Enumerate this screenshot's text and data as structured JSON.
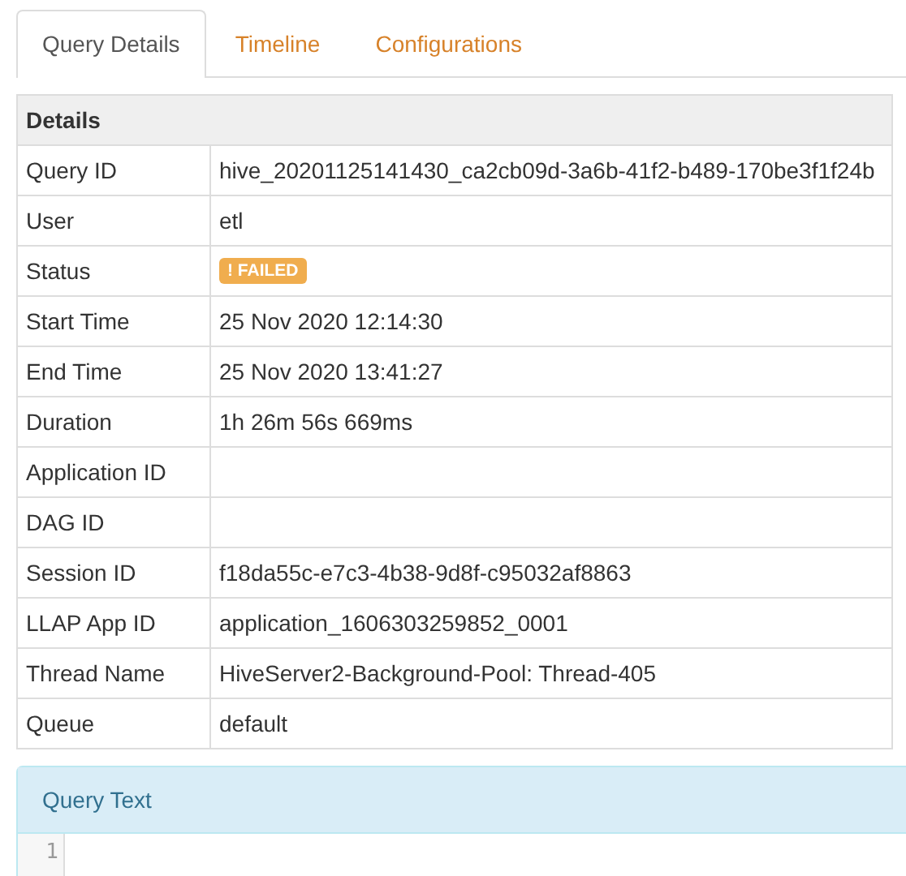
{
  "tabs": [
    {
      "label": "Query Details",
      "selected": true
    },
    {
      "label": "Timeline",
      "selected": false
    },
    {
      "label": "Configurations",
      "selected": false
    }
  ],
  "details": {
    "title": "Details",
    "rows": [
      {
        "label": "Query ID",
        "kind": "text",
        "value": "hive_20201125141430_ca2cb09d-3a6b-41f2-b489-170be3f1f24b"
      },
      {
        "label": "User",
        "kind": "text",
        "value": "etl"
      },
      {
        "label": "Status",
        "kind": "badge",
        "value": "! FAILED",
        "color": "#f0ad4e"
      },
      {
        "label": "Start Time",
        "kind": "text",
        "value": "25 Nov 2020 12:14:30"
      },
      {
        "label": "End Time",
        "kind": "text",
        "value": "25 Nov 2020 13:41:27"
      },
      {
        "label": "Duration",
        "kind": "text",
        "value": "1h 26m 56s 669ms"
      },
      {
        "label": "Application ID",
        "kind": "text"
      },
      {
        "label": "DAG ID",
        "kind": "text"
      },
      {
        "label": "Session ID",
        "kind": "text",
        "value": "f18da55c-e7c3-4b38-9d8f-c95032af8863"
      },
      {
        "label": "LLAP App ID",
        "kind": "text",
        "value": "application_1606303259852_0001"
      },
      {
        "label": "Thread Name",
        "kind": "text",
        "value": "HiveServer2-Background-Pool: Thread-405"
      },
      {
        "label": "Queue",
        "kind": "text",
        "value": "default"
      }
    ]
  },
  "query_text": {
    "title": "Query Text",
    "line_numbers": [
      "1"
    ]
  }
}
